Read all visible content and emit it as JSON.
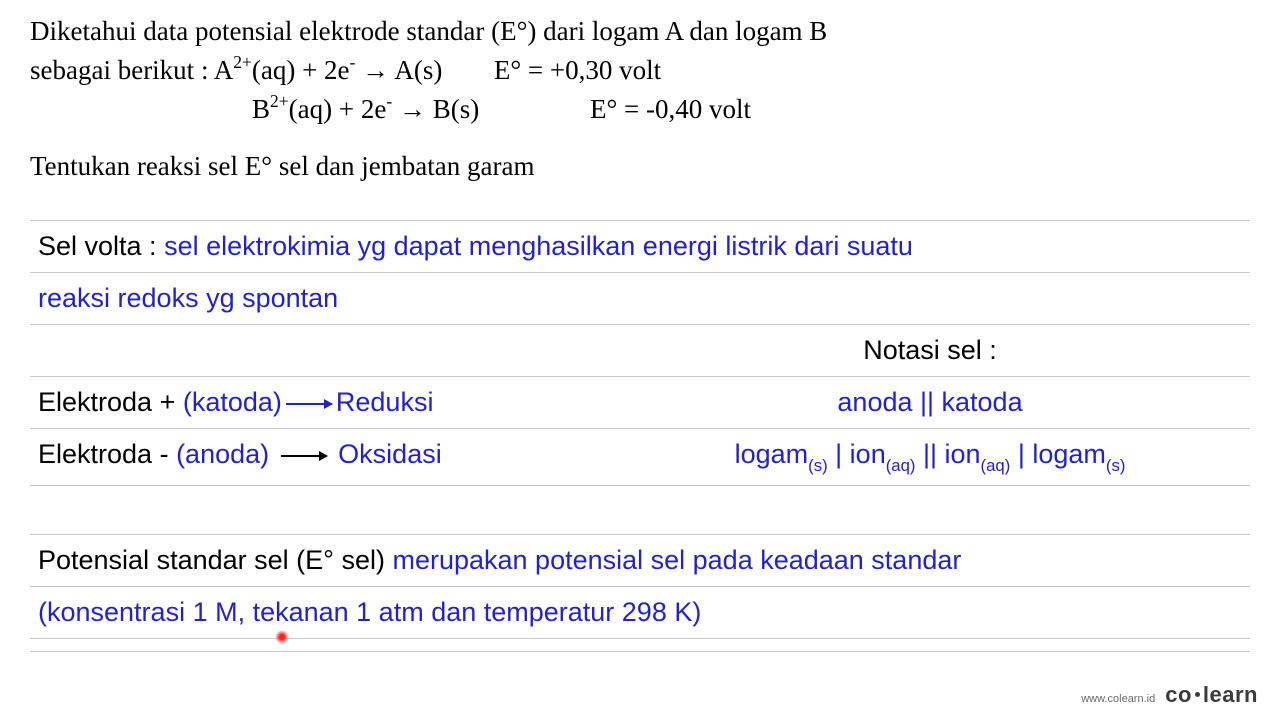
{
  "problem": {
    "line1": "Diketahui data potensial elektrode standar (E°) dari logam A dan logam B",
    "line2_prefix": "sebagai berikut  : ",
    "eqA_lhs_html": "A<sup>2+</sup>(aq) + 2e<sup>-</sup> → A(s)",
    "eqA_rhs": "E°  = +0,30 volt",
    "eqB_lhs_html": "B<sup>2+</sup>(aq) + 2e<sup>-</sup> → B(s)",
    "eqB_rhs": "E°  = -0,40 volt",
    "task": "Tentukan reaksi sel E° sel dan jembatan garam"
  },
  "notes": {
    "volta_label": "Sel volta : ",
    "volta_def_1": "sel elektrokimia yg dapat menghasilkan energi listrik dari suatu",
    "volta_def_2": "reaksi redoks yg spontan",
    "notasi_title": "Notasi sel :",
    "elektroda_plus_prefix": "Elektroda + ",
    "katoda": "(katoda)",
    "reduksi": "Reduksi",
    "elektroda_minus_prefix": "Elektroda - ",
    "anoda": "(anoda)",
    "oksidasi": "Oksidasi",
    "notasi_short": "anoda || katoda",
    "notasi_long_html": "logam<span class=\"sub\">(s)</span> | ion<span class=\"sub\">(aq)</span> || ion<span class=\"sub\">(aq)</span> | logam<span class=\"sub\">(s)</span>",
    "pot_label": "Potensial standar sel (E° sel) ",
    "pot_desc_1": "merupakan potensial sel pada keadaan standar",
    "pot_desc_2": "(konsentrasi 1 M, tekanan 1 atm dan temperatur 298 K)"
  },
  "brand": {
    "url": "www.colearn.id",
    "name_a": "co",
    "name_b": "learn"
  }
}
